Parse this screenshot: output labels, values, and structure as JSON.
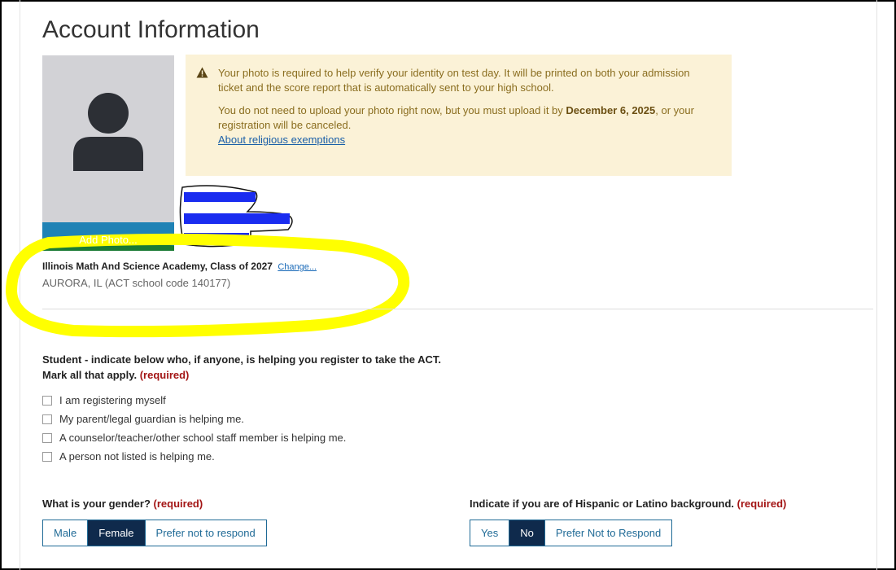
{
  "page": {
    "title": "Account Information"
  },
  "photo": {
    "add_photo_label": "Add Photo..."
  },
  "notice": {
    "line1": "Your photo is required to help verify your identity on test day. It will be printed on both your admission ticket and the score report that is automatically sent to your high school.",
    "line2_prefix": "You do not need to upload your photo right now, but you must upload it by ",
    "deadline": "December 6, 2025",
    "line2_suffix": ", or your registration will be canceled.",
    "link": "About religious exemptions"
  },
  "school": {
    "name": "Illinois Math And Science Academy, Class of 2027",
    "change_link": "Change...",
    "location": "AURORA, IL (ACT school code 140177)"
  },
  "helper_question": {
    "text": "Student - indicate below who, if anyone, is helping you register to take the ACT. Mark all that apply.",
    "required": "(required)",
    "options": [
      "I am registering myself",
      "My parent/legal guardian is helping me.",
      "A counselor/teacher/other school staff member is helping me.",
      "A person not listed is helping me."
    ]
  },
  "gender": {
    "question": "What is your gender?",
    "required": "(required)",
    "options": [
      "Male",
      "Female",
      "Prefer not to respond"
    ],
    "selected": "Female"
  },
  "hispanic": {
    "question": "Indicate if you are of Hispanic or Latino background.",
    "required": "(required)",
    "options": [
      "Yes",
      "No",
      "Prefer Not to Respond"
    ],
    "selected": "No"
  },
  "colors": {
    "accent": "#1f82b5",
    "selected_bg": "#0f2a4c",
    "required": "#a31515",
    "notice_bg": "#fbf2d7",
    "highlight": "#ffff00",
    "redaction": "#1a2cf0"
  },
  "icons": {
    "avatar": "person-silhouette-icon",
    "warning": "warning-triangle-icon"
  }
}
